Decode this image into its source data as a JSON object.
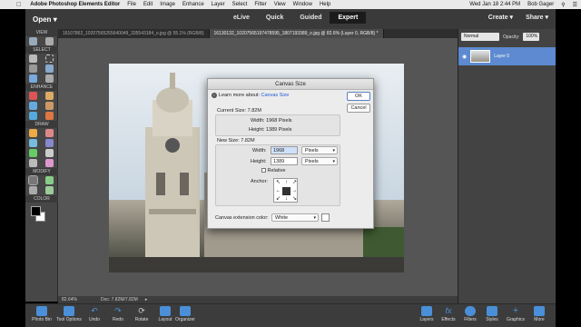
{
  "menubar": {
    "app": "Adobe Photoshop Elements Editor",
    "items": [
      "File",
      "Edit",
      "Image",
      "Enhance",
      "Layer",
      "Select",
      "Filter",
      "View",
      "Window",
      "Help"
    ],
    "clock": "Wed Jan 18  2:44 PM",
    "user": "Bob Gager"
  },
  "topbar": {
    "open_label": "Open",
    "modes": [
      "eLive",
      "Quick",
      "Guided",
      "Expert"
    ],
    "active_mode": "Expert",
    "create_label": "Create",
    "share_label": "Share"
  },
  "toolbox": {
    "sections": [
      "VIEW",
      "SELECT",
      "ENHANCE",
      "DRAW",
      "MODIFY",
      "COLOR"
    ]
  },
  "doc_tabs": [
    "16107862_10207565255640049_335543184_o.jpg @ 55.1% (RGB/8)",
    "16130132_10207565197478595_1807193389_o.jpg @ 82.6% (Layer 0, RGB/8) *"
  ],
  "statusbar": {
    "zoom": "82.64%",
    "doc": "Doc: 7.82M/7.82M"
  },
  "right_panel": {
    "blend_mode": "Normal",
    "opacity_label": "Opacity:",
    "opacity_value": "100%",
    "layer_name": "Layer 0"
  },
  "dialog": {
    "title": "Canvas Size",
    "learn_prefix": "Learn more about:",
    "learn_link": "Canvas Size",
    "ok_label": "OK",
    "cancel_label": "Cancel",
    "current_size_label": "Current Size: 7.82M",
    "current_width": "Width:  1968 Pixels",
    "current_height": "Height:  1389 Pixels",
    "new_size_label": "New Size: 7.82M",
    "width_label": "Width:",
    "width_value": "1968",
    "width_unit": "Pixels",
    "height_label": "Height:",
    "height_value": "1389",
    "height_unit": "Pixels",
    "relative_label": "Relative",
    "anchor_label": "Anchor:",
    "ext_color_label": "Canvas extension color:",
    "ext_color_value": "White"
  },
  "bottombar": {
    "buttons": [
      "Photo Bin",
      "Tool Options",
      "Undo",
      "Redo",
      "Rotate",
      "Layout",
      "Organizer",
      "Layers",
      "Effects",
      "Filters",
      "Styles",
      "Graphics",
      "More"
    ]
  }
}
